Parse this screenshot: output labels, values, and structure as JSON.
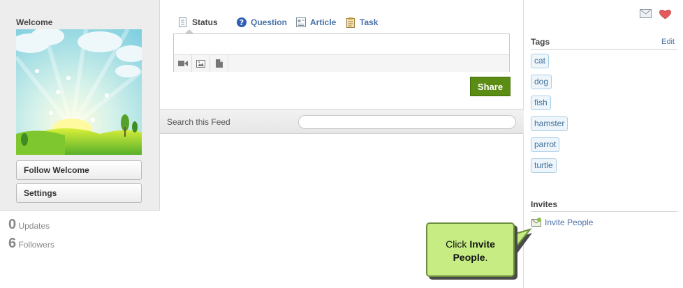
{
  "profile": {
    "title": "Welcome",
    "follow_label": "Follow Welcome",
    "settings_label": "Settings",
    "stats": {
      "updates_count": "0",
      "updates_label": "Updates",
      "followers_count": "6",
      "followers_label": "Followers"
    }
  },
  "composer": {
    "tabs": [
      {
        "label": "Status",
        "icon": "status-icon"
      },
      {
        "label": "Question",
        "icon": "question-icon"
      },
      {
        "label": "Article",
        "icon": "article-icon"
      },
      {
        "label": "Task",
        "icon": "task-icon"
      }
    ],
    "active_tab": "Status",
    "input_value": "",
    "attachments": [
      "video-icon",
      "image-icon",
      "file-icon"
    ],
    "share_label": "Share",
    "share_color": "#5b8c13"
  },
  "feed": {
    "search_label": "Search this Feed",
    "search_value": ""
  },
  "sidebar": {
    "icons": [
      "mail-icon",
      "heart-icon"
    ],
    "tags": {
      "title": "Tags",
      "edit_label": "Edit",
      "items": [
        "cat",
        "dog",
        "fish",
        "hamster",
        "parrot",
        "turtle"
      ]
    },
    "invites": {
      "title": "Invites",
      "link_label": "Invite People"
    }
  },
  "callout": {
    "text_prefix": "Click ",
    "text_bold": "Invite People",
    "text_suffix": ".",
    "color": "#c6ec83"
  },
  "colors": {
    "link": "#4a72a8",
    "tag_border": "#a9cde6",
    "left_panel": "#ededed"
  }
}
